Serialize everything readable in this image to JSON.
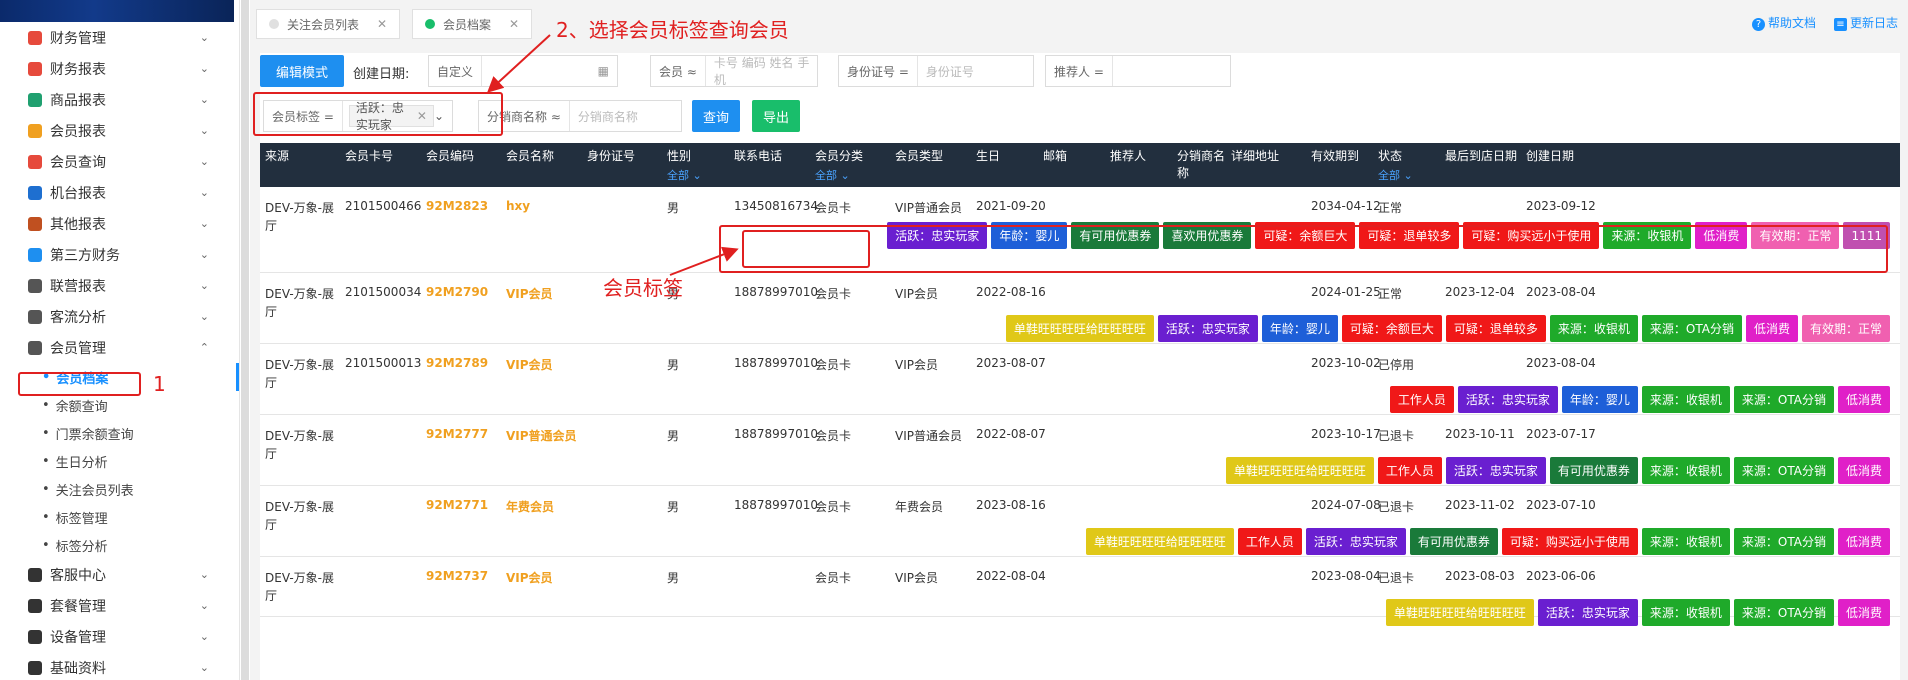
{
  "sidebar": {
    "menu": [
      {
        "label": "财务管理",
        "color": "#e64a3c"
      },
      {
        "label": "财务报表",
        "color": "#e64a3c"
      },
      {
        "label": "商品报表",
        "color": "#20a070"
      },
      {
        "label": "会员报表",
        "color": "#f0a020"
      },
      {
        "label": "会员查询",
        "color": "#e64a3c"
      },
      {
        "label": "机台报表",
        "color": "#1e6fd0"
      },
      {
        "label": "其他报表",
        "color": "#c05020"
      },
      {
        "label": "第三方财务",
        "color": "#1e8ff0"
      },
      {
        "label": "联营报表",
        "color": "#555555"
      },
      {
        "label": "客流分析",
        "color": "#555555"
      },
      {
        "label": "会员管理",
        "color": "#555555"
      }
    ],
    "submenu": [
      "会员档案",
      "余额查询",
      "门票余额查询",
      "生日分析",
      "关注会员列表",
      "标签管理",
      "标签分析"
    ],
    "menu2": [
      "客服中心",
      "套餐管理",
      "设备管理",
      "基础资料"
    ]
  },
  "tabs": [
    {
      "label": "关注会员列表",
      "dot": "#e0e0e0"
    },
    {
      "label": "会员档案",
      "dot": "#19be6b"
    }
  ],
  "toplinks": {
    "help": "帮助文档",
    "log": "更新日志"
  },
  "filters": {
    "edit_mode": "编辑模式",
    "created_label": "创建日期:",
    "date_preset": "自定义",
    "member_prefix": "会员 ≈",
    "member_placeholder": "卡号 编码 姓名 手机",
    "idcard_prefix": "身份证号 =",
    "idcard_placeholder": "身份证号",
    "referrer_prefix": "推荐人 =",
    "tag_prefix": "会员标签 =",
    "tag_value": "活跃：忠实玩家",
    "distributor_prefix": "分销商名称 ≈",
    "distributor_placeholder": "分销商名称",
    "query": "查询",
    "export": "导出"
  },
  "annotations": {
    "step1": "1",
    "step2": "2、选择会员标签查询会员",
    "tag_note": "会员标签"
  },
  "columns": [
    "来源",
    "会员卡号",
    "会员编码",
    "会员名称",
    "身份证号",
    "性别",
    "联系电话",
    "会员分类",
    "会员类型",
    "生日",
    "邮箱",
    "推荐人",
    "分销商名称",
    "详细地址",
    "有效期到",
    "状态",
    "最后到店日期",
    "创建日期"
  ],
  "all_label": "全部",
  "rows": [
    {
      "source": "DEV-万象-展厅",
      "card": "2101500466",
      "code": "92M2823",
      "name": "hxy",
      "gender": "男",
      "phone": "13450816734",
      "category": "会员卡",
      "type": "VIP普通会员",
      "birthday": "2021-09-20",
      "expire": "2034-04-12",
      "status": "正常",
      "last_visit": "",
      "created": "2023-09-12",
      "tags": [
        [
          "活跃：忠实玩家",
          "#6a1fd0"
        ],
        [
          "年龄：婴儿",
          "#1e5fd8"
        ],
        [
          "有可用优惠券",
          "#1a7a3a"
        ],
        [
          "喜欢用优惠券",
          "#1a7a3a"
        ],
        [
          "可疑：余额巨大",
          "#f01818"
        ],
        [
          "可疑：退单较多",
          "#f01818"
        ],
        [
          "可疑：购买远小于使用",
          "#f01818"
        ],
        [
          "来源：收银机",
          "#1faa2a"
        ],
        [
          "低消费",
          "#e020c8"
        ],
        [
          "有效期：正常",
          "#f060b0"
        ],
        [
          "1111",
          "#c050b0"
        ]
      ]
    },
    {
      "source": "DEV-万象-展厅",
      "card": "2101500034",
      "code": "92M2790",
      "name": "VIP会员",
      "gender": "男",
      "phone": "18878997010",
      "category": "会员卡",
      "type": "VIP会员",
      "birthday": "2022-08-16",
      "expire": "2024-01-25",
      "status": "正常",
      "last_visit": "2023-12-04",
      "created": "2023-08-04",
      "tags": [
        [
          "单鞋旺旺旺旺给旺旺旺旺",
          "#e0c818"
        ],
        [
          "活跃：忠实玩家",
          "#6a1fd0"
        ],
        [
          "年龄：婴儿",
          "#1e5fd8"
        ],
        [
          "可疑：余额巨大",
          "#f01818"
        ],
        [
          "可疑：退单较多",
          "#f01818"
        ],
        [
          "来源：收银机",
          "#1faa2a"
        ],
        [
          "来源：OTA分销",
          "#1faa2a"
        ],
        [
          "低消费",
          "#e020c8"
        ],
        [
          "有效期：正常",
          "#f060b0"
        ]
      ]
    },
    {
      "source": "DEV-万象-展厅",
      "card": "2101500013",
      "code": "92M2789",
      "name": "VIP会员",
      "gender": "男",
      "phone": "18878997010",
      "category": "会员卡",
      "type": "VIP会员",
      "birthday": "2023-08-07",
      "expire": "2023-10-02",
      "status": "已停用",
      "last_visit": "",
      "created": "2023-08-04",
      "tags": [
        [
          "工作人员",
          "#f01818"
        ],
        [
          "活跃：忠实玩家",
          "#6a1fd0"
        ],
        [
          "年龄：婴儿",
          "#1e5fd8"
        ],
        [
          "来源：收银机",
          "#1faa2a"
        ],
        [
          "来源：OTA分销",
          "#1faa2a"
        ],
        [
          "低消费",
          "#e020c8"
        ]
      ]
    },
    {
      "source": "DEV-万象-展厅",
      "card": "",
      "code": "92M2777",
      "name": "VIP普通会员",
      "gender": "男",
      "phone": "18878997010",
      "category": "会员卡",
      "type": "VIP普通会员",
      "birthday": "2022-08-07",
      "expire": "2023-10-17",
      "status": "已退卡",
      "last_visit": "2023-10-11",
      "created": "2023-07-17",
      "tags": [
        [
          "单鞋旺旺旺旺给旺旺旺旺",
          "#e0c818"
        ],
        [
          "工作人员",
          "#f01818"
        ],
        [
          "活跃：忠实玩家",
          "#6a1fd0"
        ],
        [
          "有可用优惠券",
          "#1a7a3a"
        ],
        [
          "来源：收银机",
          "#1faa2a"
        ],
        [
          "来源：OTA分销",
          "#1faa2a"
        ],
        [
          "低消费",
          "#e020c8"
        ]
      ]
    },
    {
      "source": "DEV-万象-展厅",
      "card": "",
      "code": "92M2771",
      "name": "年费会员",
      "gender": "男",
      "phone": "18878997010",
      "category": "会员卡",
      "type": "年费会员",
      "birthday": "2023-08-16",
      "expire": "2024-07-08",
      "status": "已退卡",
      "last_visit": "2023-11-02",
      "created": "2023-07-10",
      "tags": [
        [
          "单鞋旺旺旺旺给旺旺旺旺",
          "#e0c818"
        ],
        [
          "工作人员",
          "#f01818"
        ],
        [
          "活跃：忠实玩家",
          "#6a1fd0"
        ],
        [
          "有可用优惠券",
          "#1a7a3a"
        ],
        [
          "可疑：购买远小于使用",
          "#f01818"
        ],
        [
          "来源：收银机",
          "#1faa2a"
        ],
        [
          "来源：OTA分销",
          "#1faa2a"
        ],
        [
          "低消费",
          "#e020c8"
        ]
      ]
    },
    {
      "source": "DEV-万象-展厅",
      "card": "",
      "code": "92M2737",
      "name": "VIP会员",
      "gender": "男",
      "phone": "",
      "category": "会员卡",
      "type": "VIP会员",
      "birthday": "2022-08-04",
      "expire": "2023-08-04",
      "status": "已退卡",
      "last_visit": "2023-08-03",
      "created": "2023-06-06",
      "tags": [
        [
          "单鞋旺旺旺旺给旺旺旺旺",
          "#e0c818"
        ],
        [
          "活跃：忠实玩家",
          "#6a1fd0"
        ],
        [
          "来源：收银机",
          "#1faa2a"
        ],
        [
          "来源：OTA分销",
          "#1faa2a"
        ],
        [
          "低消费",
          "#e020c8"
        ]
      ]
    }
  ]
}
